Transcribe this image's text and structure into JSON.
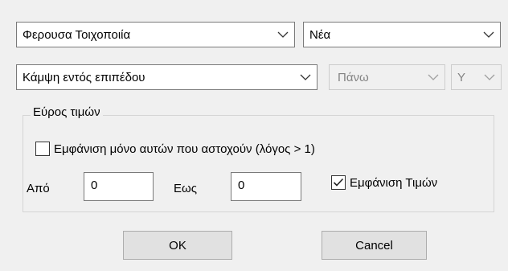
{
  "element_combo": {
    "value": "Φερουσα Τοιχοποιία"
  },
  "state_combo": {
    "value": "Νέα"
  },
  "check_type_combo": {
    "value": "Κάμψη εντός επιπέδου"
  },
  "position_combo": {
    "value": "Πάνω"
  },
  "axis_combo": {
    "value": "Y"
  },
  "range_group": {
    "title": "Εύρος τιμών",
    "show_failing_label": "Εμφάνιση μόνο αυτών που αστοχούν (λόγος > 1)",
    "show_failing_checked": false,
    "from_label": "Από",
    "from_value": "0",
    "to_label": "Εως",
    "to_value": "0",
    "show_values_label": "Εμφάνιση Τιμών",
    "show_values_checked": true
  },
  "buttons": {
    "ok": "OK",
    "cancel": "Cancel"
  },
  "colors": {
    "dialog_bg": "#f0f0f0",
    "button_bg": "#e1e1e1",
    "disabled_text": "#838383"
  }
}
